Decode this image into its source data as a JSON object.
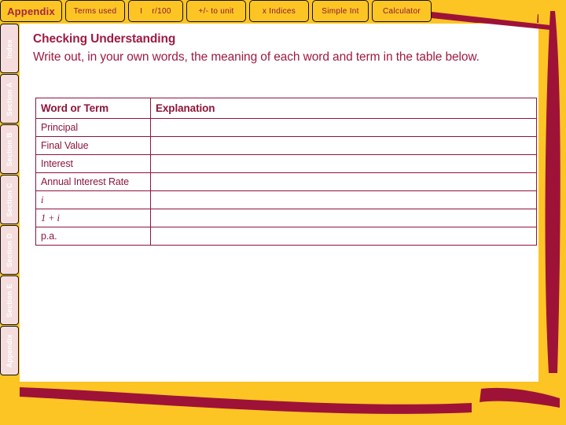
{
  "colors": {
    "gold": "#FCC524",
    "crimson": "#8E1538",
    "deep_red": "#9E1B41",
    "side_tab": "#F5DCDD",
    "white": "#FFFFFF",
    "border": "#111111"
  },
  "top_tabs": [
    {
      "label": "Appendix",
      "active": true,
      "width_class": "tab-w1"
    },
    {
      "label": "Terms used",
      "active": false,
      "width_class": "tab-w2"
    },
    {
      "label": "I",
      "label2": "r/100",
      "active": false,
      "width_class": "tab-w3"
    },
    {
      "label": "+/-  to unit",
      "active": false,
      "width_class": "tab-w4"
    },
    {
      "label": "x  Indices",
      "active": false,
      "width_class": "tab-w5"
    },
    {
      "label": "Simple Int",
      "active": false,
      "width_class": "tab-w6"
    },
    {
      "label": "Calculator",
      "active": false,
      "width_class": "tab-w7"
    }
  ],
  "side_tabs": [
    {
      "label": "Index"
    },
    {
      "label": "Section A"
    },
    {
      "label": "Section B"
    },
    {
      "label": "Section C"
    },
    {
      "label": "Section D"
    },
    {
      "label": "Section E"
    },
    {
      "label": "Appendix"
    }
  ],
  "content": {
    "heading": "Checking Understanding",
    "body": "Write out, in your own words, the meaning of each word and term in the table below."
  },
  "table": {
    "headers": [
      "Word or Term",
      "Explanation"
    ],
    "rows": [
      {
        "term": "Principal",
        "explanation": ""
      },
      {
        "term": "Final Value",
        "explanation": ""
      },
      {
        "term": "Interest",
        "explanation": ""
      },
      {
        "term": "Annual Interest Rate",
        "explanation": ""
      },
      {
        "term": "i",
        "italic": true,
        "explanation": ""
      },
      {
        "term": "1 + i",
        "italic_tail": true,
        "explanation": ""
      },
      {
        "term": "p.a.",
        "explanation": ""
      }
    ]
  }
}
